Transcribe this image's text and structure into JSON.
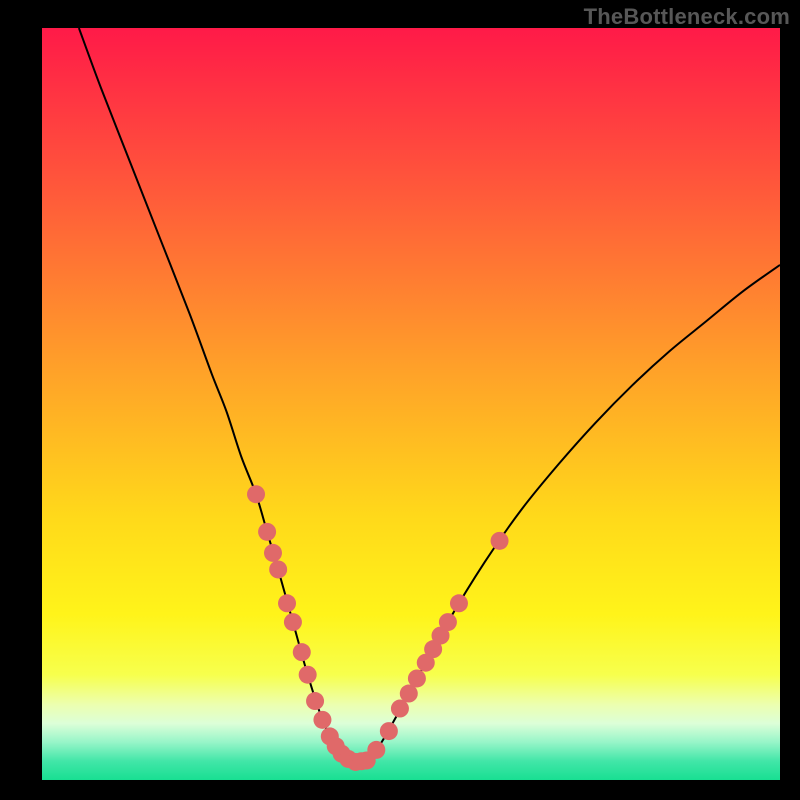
{
  "watermark": "TheBottleneck.com",
  "colors": {
    "frame": "#000000",
    "watermark": "#575757",
    "curve": "#000000",
    "marker_fill": "#e06969",
    "marker_stroke": "#d85a5a",
    "gradient_stops": [
      {
        "offset": 0.0,
        "color": "#ff1a48"
      },
      {
        "offset": 0.22,
        "color": "#ff5a3a"
      },
      {
        "offset": 0.45,
        "color": "#ffa029"
      },
      {
        "offset": 0.65,
        "color": "#ffd91a"
      },
      {
        "offset": 0.78,
        "color": "#fff41a"
      },
      {
        "offset": 0.86,
        "color": "#f7ff4d"
      },
      {
        "offset": 0.9,
        "color": "#ecffb0"
      },
      {
        "offset": 0.925,
        "color": "#dcffd8"
      },
      {
        "offset": 0.95,
        "color": "#96f5c8"
      },
      {
        "offset": 0.975,
        "color": "#42e6a8"
      },
      {
        "offset": 1.0,
        "color": "#18df92"
      }
    ]
  },
  "chart_data": {
    "type": "line",
    "title": "",
    "xlabel": "",
    "ylabel": "",
    "xlim": [
      0,
      100
    ],
    "ylim": [
      0,
      100
    ],
    "series": [
      {
        "name": "curve",
        "x": [
          5,
          8,
          12,
          16,
          20,
          23,
          25,
          27,
          29,
          30.5,
          32,
          34,
          36,
          38,
          39.5,
          41,
          42.5,
          44,
          46,
          50,
          55,
          60,
          65,
          70,
          75,
          80,
          85,
          90,
          95,
          100
        ],
        "y": [
          100,
          92,
          82,
          72,
          62,
          54,
          49,
          43,
          38,
          33,
          28,
          21,
          14,
          8,
          5,
          3.2,
          2.4,
          2.6,
          5,
          12,
          21,
          29,
          36,
          42,
          47.5,
          52.5,
          57,
          61,
          65,
          68.5
        ]
      }
    ],
    "markers": {
      "name": "highlighted-points",
      "points": [
        {
          "x": 29.0,
          "y": 38.0
        },
        {
          "x": 30.5,
          "y": 33.0
        },
        {
          "x": 31.3,
          "y": 30.2
        },
        {
          "x": 32.0,
          "y": 28.0
        },
        {
          "x": 33.2,
          "y": 23.5
        },
        {
          "x": 34.0,
          "y": 21.0
        },
        {
          "x": 35.2,
          "y": 17.0
        },
        {
          "x": 36.0,
          "y": 14.0
        },
        {
          "x": 37.0,
          "y": 10.5
        },
        {
          "x": 38.0,
          "y": 8.0
        },
        {
          "x": 39.0,
          "y": 5.8
        },
        {
          "x": 39.8,
          "y": 4.5
        },
        {
          "x": 40.6,
          "y": 3.5
        },
        {
          "x": 41.5,
          "y": 2.8
        },
        {
          "x": 42.5,
          "y": 2.4
        },
        {
          "x": 43.3,
          "y": 2.5
        },
        {
          "x": 44.0,
          "y": 2.6
        },
        {
          "x": 45.3,
          "y": 4.0
        },
        {
          "x": 47.0,
          "y": 6.5
        },
        {
          "x": 48.5,
          "y": 9.5
        },
        {
          "x": 49.7,
          "y": 11.5
        },
        {
          "x": 50.8,
          "y": 13.5
        },
        {
          "x": 52.0,
          "y": 15.6
        },
        {
          "x": 53.0,
          "y": 17.4
        },
        {
          "x": 54.0,
          "y": 19.2
        },
        {
          "x": 55.0,
          "y": 21.0
        },
        {
          "x": 56.5,
          "y": 23.5
        },
        {
          "x": 62.0,
          "y": 31.8
        }
      ]
    }
  }
}
